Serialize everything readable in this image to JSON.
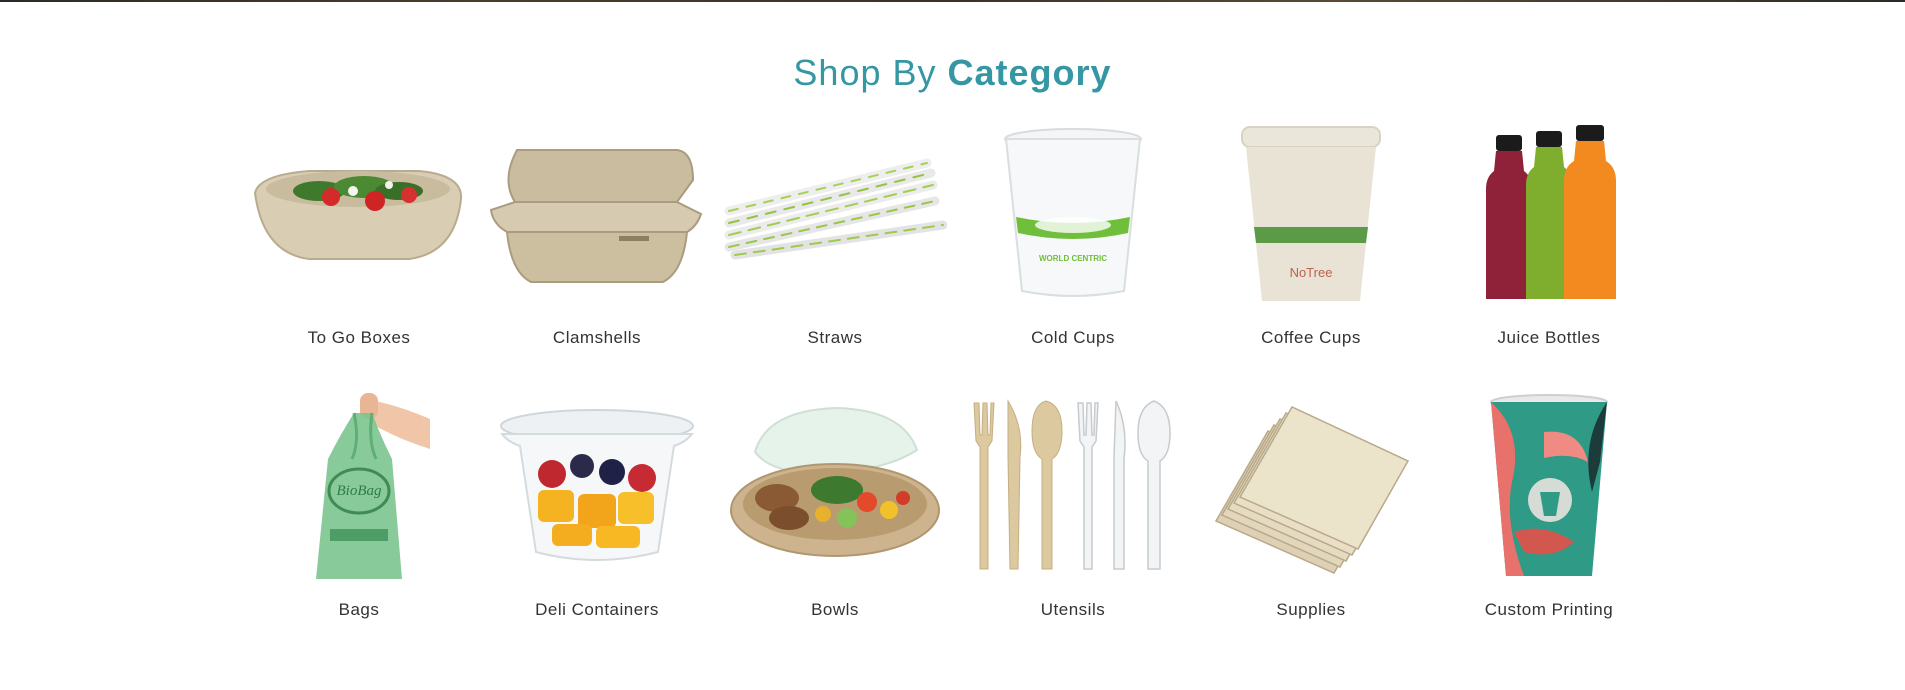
{
  "section": {
    "title_light": "Shop By",
    "title_bold": "Category",
    "accent_color": "#3596a4"
  },
  "categories": [
    {
      "label": "To Go Boxes",
      "icon": "salad-box-image"
    },
    {
      "label": "Clamshells",
      "icon": "clamshell-image"
    },
    {
      "label": "Straws",
      "icon": "straws-image"
    },
    {
      "label": "Cold Cups",
      "icon": "cold-cup-image",
      "cup_text": "WORLD CENTRIC"
    },
    {
      "label": "Coffee Cups",
      "icon": "coffee-cup-image",
      "cup_text": "NoTree"
    },
    {
      "label": "Juice Bottles",
      "icon": "juice-bottles-image"
    },
    {
      "label": "Bags",
      "icon": "bag-image",
      "bag_text": "BioBag"
    },
    {
      "label": "Deli Containers",
      "icon": "deli-container-image"
    },
    {
      "label": "Bowls",
      "icon": "bowl-image"
    },
    {
      "label": "Utensils",
      "icon": "utensils-image"
    },
    {
      "label": "Supplies",
      "icon": "napkins-image"
    },
    {
      "label": "Custom Printing",
      "icon": "custom-cup-image"
    }
  ]
}
